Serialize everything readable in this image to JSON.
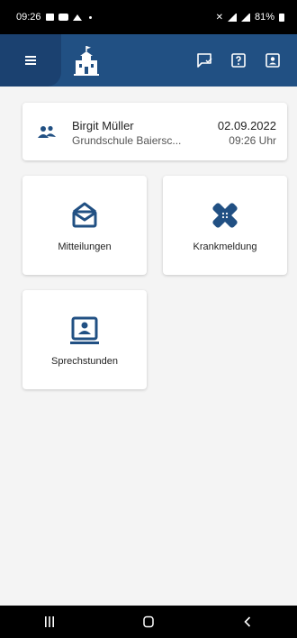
{
  "status_bar": {
    "time": "09:26",
    "battery": "81%"
  },
  "app_bar": {
    "icons": [
      "menu-icon",
      "school-building-icon",
      "chat-icon",
      "help-icon",
      "contact-card-icon"
    ]
  },
  "profile": {
    "name": "Birgit Müller",
    "school": "Grundschule Baiersc...",
    "date": "02.09.2022",
    "time": "09:26 Uhr"
  },
  "tiles": [
    {
      "label": "Mitteilungen",
      "icon": "envelope-icon"
    },
    {
      "label": "Krankmeldung",
      "icon": "bandage-icon"
    },
    {
      "label": "Sprechstunden",
      "icon": "contact-card-icon"
    }
  ],
  "colors": {
    "primary": "#215083",
    "primary_dark": "#1b4170",
    "background": "#f4f4f4",
    "card": "#ffffff",
    "system_bar": "#000000"
  }
}
